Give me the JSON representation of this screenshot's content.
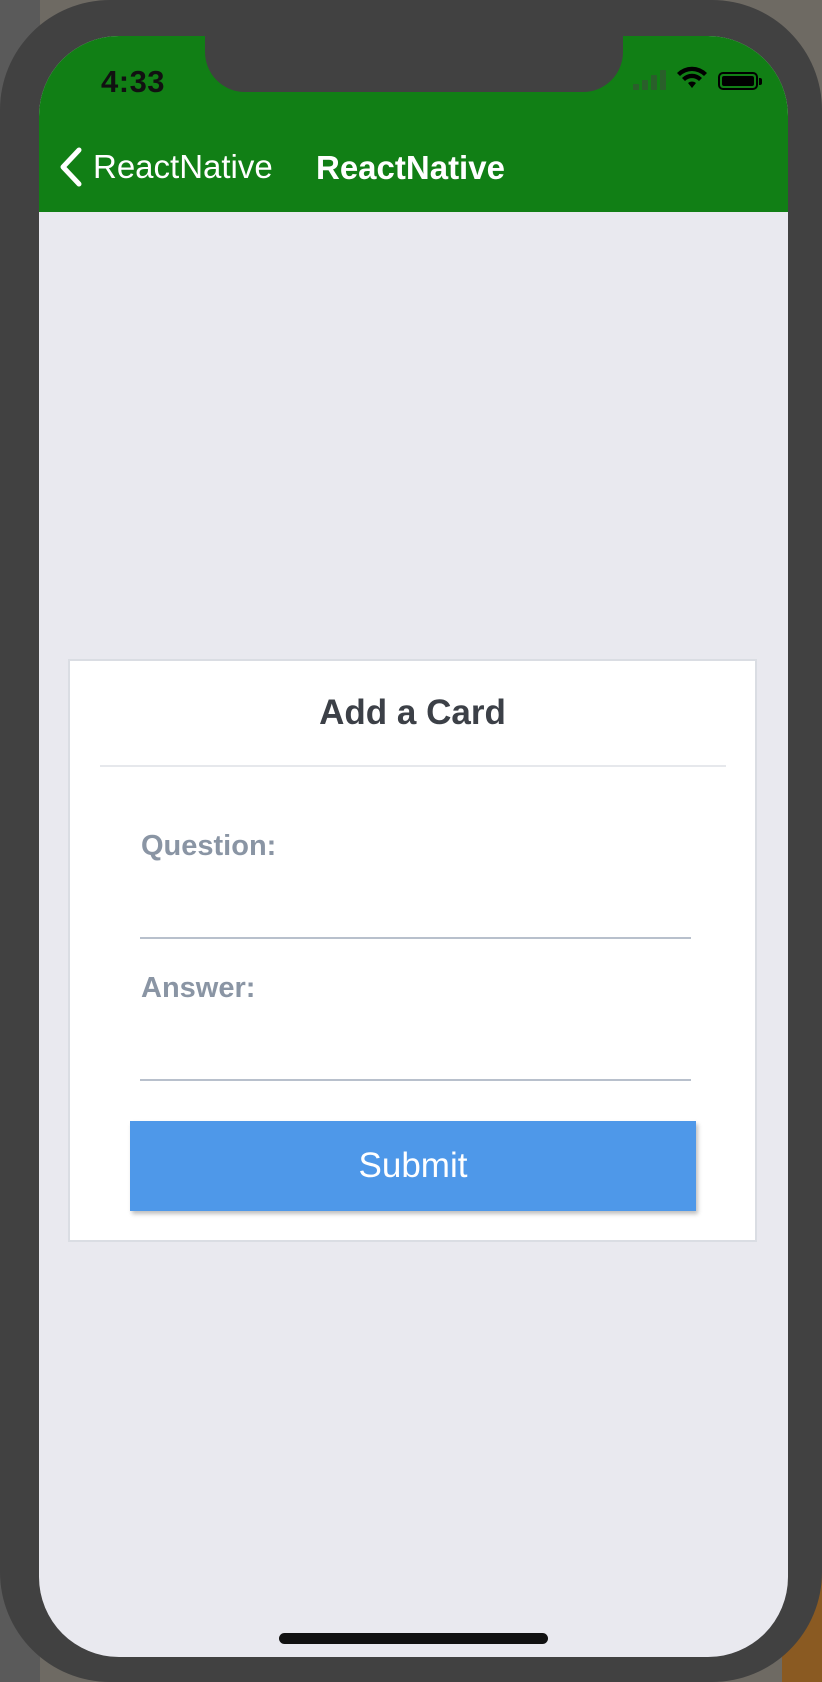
{
  "status_bar": {
    "time": "4:33",
    "icons": [
      "signal-icon",
      "wifi-icon",
      "battery-icon"
    ]
  },
  "nav": {
    "back_label": "ReactNative",
    "title": "ReactNative",
    "back_icon": "chevron-left-icon"
  },
  "card": {
    "title": "Add a Card",
    "question_label": "Question:",
    "question_value": "",
    "answer_label": "Answer:",
    "answer_value": "",
    "submit_label": "Submit"
  },
  "colors": {
    "header_bg": "#117f15",
    "screen_bg": "#e9e9ef",
    "submit_bg": "#4e98e9",
    "label_color": "#8a95a4"
  }
}
